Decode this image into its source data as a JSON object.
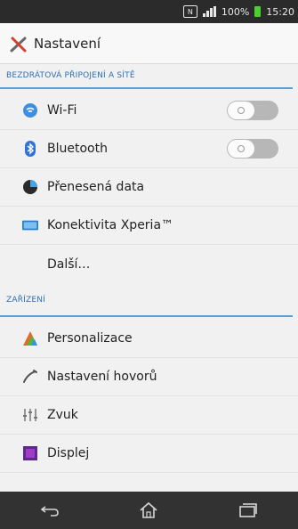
{
  "status": {
    "nfc": "N",
    "battery_pct": "100%",
    "time": "15:20"
  },
  "actionbar": {
    "title": "Nastavení",
    "icon": "settings-tools-icon"
  },
  "sections": [
    {
      "title": "BEZDRÁTOVÁ PŘIPOJENÍ A SÍTĚ"
    },
    {
      "title": "ZAŘÍZENÍ"
    }
  ],
  "items": {
    "wifi": {
      "label": "Wi-Fi",
      "icon": "wifi-icon",
      "toggle": "off"
    },
    "bluetooth": {
      "label": "Bluetooth",
      "icon": "bluetooth-icon",
      "toggle": "off"
    },
    "data": {
      "label": "Přenesená data",
      "icon": "data-usage-icon"
    },
    "xperia": {
      "label": "Konektivita Xperia™",
      "icon": "xperia-connectivity-icon"
    },
    "more": {
      "label": "Další…"
    },
    "personalize": {
      "label": "Personalizace",
      "icon": "personalization-icon"
    },
    "calls": {
      "label": "Nastavení hovorů",
      "icon": "phone-icon"
    },
    "sound": {
      "label": "Zvuk",
      "icon": "sound-icon"
    },
    "display": {
      "label": "Displej",
      "icon": "display-icon"
    }
  },
  "colors": {
    "accent": "#2f6fb1",
    "statusbar": "#2b2b2b",
    "navbar": "#323232"
  }
}
